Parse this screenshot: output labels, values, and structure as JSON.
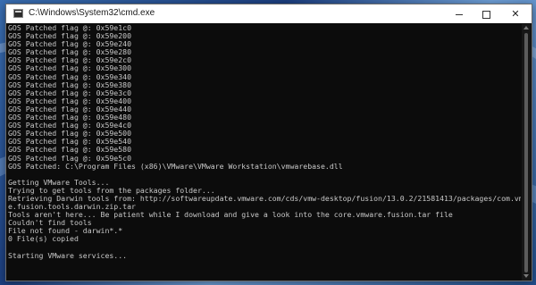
{
  "window": {
    "title": "C:\\Windows\\System32\\cmd.exe",
    "min_symbol": "",
    "max_symbol": "",
    "close_symbol": "✕"
  },
  "console": {
    "lines": [
      "GOS Patched flag @: 0x59e1c0",
      "GOS Patched flag @: 0x59e200",
      "GOS Patched flag @: 0x59e240",
      "GOS Patched flag @: 0x59e280",
      "GOS Patched flag @: 0x59e2c0",
      "GOS Patched flag @: 0x59e300",
      "GOS Patched flag @: 0x59e340",
      "GOS Patched flag @: 0x59e380",
      "GOS Patched flag @: 0x59e3c0",
      "GOS Patched flag @: 0x59e400",
      "GOS Patched flag @: 0x59e440",
      "GOS Patched flag @: 0x59e480",
      "GOS Patched flag @: 0x59e4c0",
      "GOS Patched flag @: 0x59e500",
      "GOS Patched flag @: 0x59e540",
      "GOS Patched flag @: 0x59e580",
      "GOS Patched flag @: 0x59e5c0",
      "GOS Patched: C:\\Program Files (x86)\\VMware\\VMware Workstation\\vmwarebase.dll",
      "",
      "Getting VMware Tools...",
      "Trying to get tools from the packages folder...",
      "Retrieving Darwin tools from: http://softwareupdate.vmware.com/cds/vmw-desktop/fusion/13.0.2/21581413/packages/com.vmwar",
      "e.fusion.tools.darwin.zip.tar",
      "Tools aren't here... Be patient while I download and give a look into the core.vmware.fusion.tar file",
      "Couldn't find tools",
      "File not found - darwin*.*",
      "0 File(s) copied",
      "",
      "Starting VMware services..."
    ]
  }
}
